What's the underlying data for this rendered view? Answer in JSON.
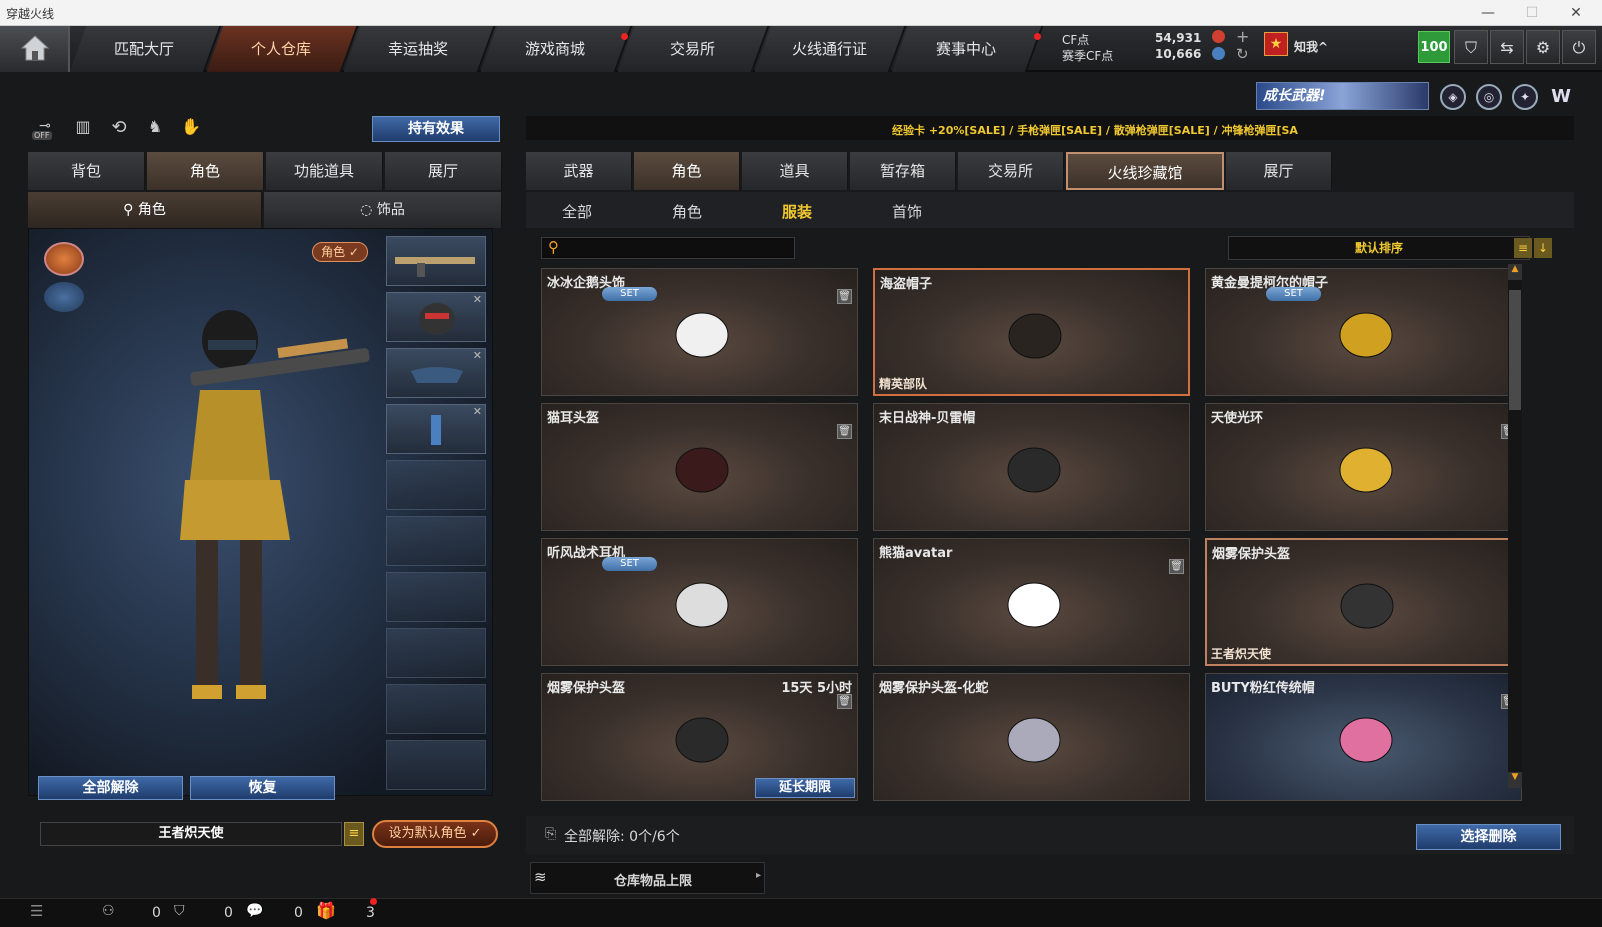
{
  "window": {
    "title": "穿越火线",
    "min": "—",
    "max": "☐",
    "close": "✕"
  },
  "nav": {
    "tabs": [
      "匹配大厅",
      "个人仓库",
      "幸运抽奖",
      "游戏商城",
      "交易所",
      "火线通行证",
      "赛事中心"
    ]
  },
  "currency": {
    "cf_label": "CF点",
    "cf_value": "54,931",
    "season_label": "赛季CF点",
    "season_value": "10,666"
  },
  "user": {
    "name": "知我^",
    "level": "100"
  },
  "left": {
    "effect_btn": "持有效果",
    "off_label": "OFF",
    "tabs": [
      "背包",
      "角色",
      "功能道具",
      "展厅"
    ],
    "subtabs": [
      "角色",
      "饰品"
    ],
    "role_badge": "角色 ✓",
    "btn_unequip": "全部解除",
    "btn_restore": "恢复",
    "role_name": "王者炽天使",
    "btn_default": "设为默认角色 ✓"
  },
  "banner": {
    "promo": "成长武器!",
    "sale": "经验卡 +20%[SALE] / 手枪弹匣[SALE] / 散弹枪弹匣[SALE] / 冲锋枪弹匣[SA"
  },
  "right": {
    "tabs": [
      "武器",
      "角色",
      "道具",
      "暂存箱",
      "交易所",
      "火线珍藏馆",
      "展厅"
    ],
    "subtabs": [
      "全部",
      "角色",
      "服装",
      "首饰"
    ],
    "search_placeholder": "",
    "sort_label": "默认排序",
    "items": [
      {
        "name": "冰冰企鹅头饰",
        "set": "SET",
        "trash": true
      },
      {
        "name": "海盗帽子",
        "tag": "精英部队"
      },
      {
        "name": "黄金曼提柯尔的帽子",
        "set": "SET"
      },
      {
        "name": "猫耳头盔",
        "trash": true
      },
      {
        "name": "末日战神-贝雷帽"
      },
      {
        "name": "天使光环",
        "trash": true
      },
      {
        "name": "听风战术耳机",
        "set": "SET"
      },
      {
        "name": "熊猫avatar",
        "trash": true
      },
      {
        "name": "烟雾保护头盔",
        "tag": "王者炽天使"
      },
      {
        "name": "烟雾保护头盔",
        "time": "15天 5小时",
        "trash": true,
        "extend": "延长期限"
      },
      {
        "name": "烟雾保护头盔-化蛇"
      },
      {
        "name": "BUTY粉红传统帽",
        "trash": true
      }
    ],
    "unequip_status": "全部解除: 0个/6个",
    "btn_select_delete": "选择删除",
    "storage_limit": "仓库物品上限"
  },
  "bottom": {
    "c1": "0",
    "c2": "0",
    "c3": "0",
    "c4": "3"
  }
}
